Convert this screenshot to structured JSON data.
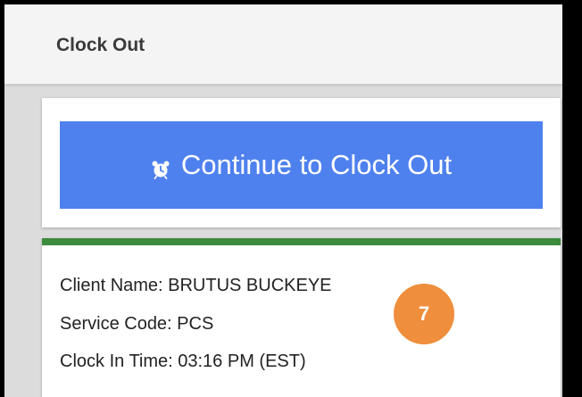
{
  "header": {
    "title": "Clock Out"
  },
  "action": {
    "button_label": "Continue to Clock Out",
    "icon": "alarm-clock-icon",
    "color": "#4f81ee"
  },
  "info": {
    "accent_color": "#3d8b3d",
    "client_name": "Client Name: BRUTUS BUCKEYE",
    "service_code": "Service Code: PCS",
    "clock_in_time": "Clock In Time: 03:16 PM (EST)"
  },
  "annotation": {
    "step_number": "7",
    "color": "#ef8e3c"
  }
}
